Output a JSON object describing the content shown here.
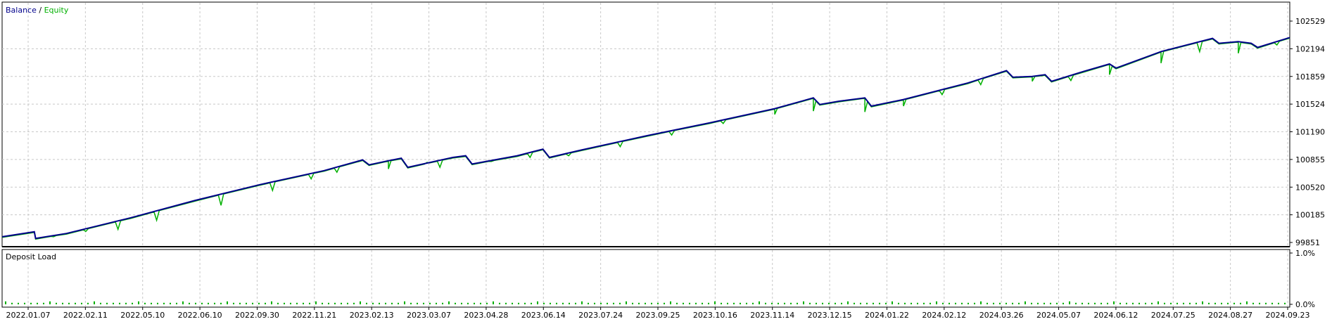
{
  "chart_data": {
    "type": "line",
    "panes": {
      "main": {
        "legend": {
          "placement": "top-left",
          "separator": " / "
        },
        "series": [
          {
            "name": "Balance",
            "color": "#00008b"
          },
          {
            "name": "Equity",
            "color": "#00b000"
          }
        ],
        "y_ticks": [
          "102529",
          "102194",
          "101859",
          "101524",
          "101190",
          "100855",
          "100520",
          "100185",
          "99851"
        ],
        "ylim": [
          99851,
          102529
        ],
        "balance_x": [
          0.0,
          0.025,
          0.026,
          0.05,
          0.1,
          0.15,
          0.2,
          0.25,
          0.28,
          0.285,
          0.3,
          0.31,
          0.315,
          0.35,
          0.36,
          0.365,
          0.4,
          0.42,
          0.425,
          0.45,
          0.5,
          0.55,
          0.6,
          0.63,
          0.635,
          0.65,
          0.67,
          0.675,
          0.7,
          0.75,
          0.78,
          0.785,
          0.8,
          0.81,
          0.815,
          0.84,
          0.86,
          0.865,
          0.9,
          0.94,
          0.945,
          0.96,
          0.97,
          0.975,
          1.0
        ],
        "balance_y": [
          99920,
          99980,
          99900,
          99960,
          100150,
          100360,
          100550,
          100720,
          100850,
          100790,
          100840,
          100870,
          100760,
          100880,
          100900,
          100800,
          100900,
          100980,
          100880,
          100970,
          101140,
          101300,
          101470,
          101600,
          101520,
          101560,
          101600,
          101500,
          101580,
          101780,
          101930,
          101850,
          101860,
          101880,
          101800,
          101920,
          102010,
          101960,
          102160,
          102320,
          102260,
          102280,
          102260,
          102210,
          102330
        ],
        "equity_dips_x": [
          0.04,
          0.065,
          0.09,
          0.12,
          0.17,
          0.21,
          0.24,
          0.26,
          0.3,
          0.33,
          0.34,
          0.38,
          0.41,
          0.44,
          0.48,
          0.52,
          0.56,
          0.6,
          0.63,
          0.67,
          0.7,
          0.73,
          0.76,
          0.8,
          0.83,
          0.86,
          0.9,
          0.93,
          0.96,
          0.99
        ],
        "equity_dips_y": [
          99920,
          99985,
          100010,
          100120,
          100300,
          100480,
          100620,
          100700,
          100740,
          100820,
          100760,
          100830,
          100880,
          100900,
          101010,
          101150,
          101290,
          101400,
          101440,
          101430,
          101500,
          101640,
          101760,
          101800,
          101810,
          101880,
          102020,
          102160,
          102140,
          102240
        ]
      },
      "deposit_load": {
        "label": "Deposit Load",
        "y_ticks": [
          "1.0%",
          "0.0%"
        ],
        "ylim": [
          0,
          1
        ],
        "bars_region_x": [
          0.0,
          1.0
        ],
        "bar_value": 0.03,
        "color": "#00b000"
      }
    },
    "x_ticks": [
      "2022.01.07",
      "2022.02.11",
      "2022.05.10",
      "2022.06.10",
      "2022.09.30",
      "2022.11.21",
      "2023.02.13",
      "2023.03.07",
      "2023.04.28",
      "2023.06.14",
      "2023.07.24",
      "2023.09.25",
      "2023.10.16",
      "2023.11.14",
      "2023.12.15",
      "2024.01.22",
      "2024.02.12",
      "2024.03.26",
      "2024.05.07",
      "2024.06.12",
      "2024.07.25",
      "2024.08.27",
      "2024.09.23"
    ],
    "grid": true
  }
}
